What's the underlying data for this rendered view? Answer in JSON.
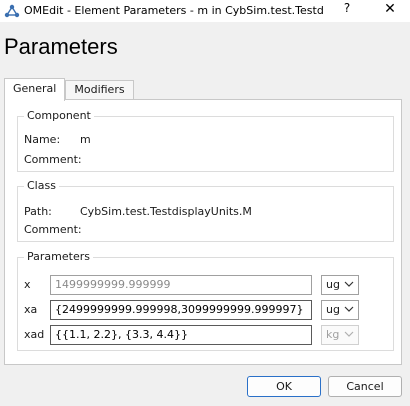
{
  "window": {
    "title": "OMEdit - Element Parameters - m in CybSim.test.Testdi...",
    "help_label": "?",
    "close_label": "✕"
  },
  "header": {
    "title": "Parameters"
  },
  "tabs": [
    {
      "label": "General",
      "active": true
    },
    {
      "label": "Modifiers",
      "active": false
    }
  ],
  "component": {
    "title": "Component",
    "name_label": "Name:",
    "name_value": "m",
    "comment_label": "Comment:",
    "comment_value": ""
  },
  "class_group": {
    "title": "Class",
    "path_label": "Path:",
    "path_value": "CybSim.test.TestdisplayUnits.M",
    "comment_label": "Comment:",
    "comment_value": ""
  },
  "parameters": {
    "title": "Parameters",
    "rows": [
      {
        "label": "x",
        "value": "1499999999.999999",
        "is_placeholder": true,
        "unit": "ug",
        "unit_enabled": true
      },
      {
        "label": "xa",
        "value": "{2499999999.999998,3099999999.999997}",
        "is_placeholder": false,
        "unit": "ug",
        "unit_enabled": true
      },
      {
        "label": "xad",
        "value": "{{1.1, 2.2}, {3.3, 4.4}}",
        "is_placeholder": false,
        "unit": "kg",
        "unit_enabled": false
      }
    ]
  },
  "buttons": {
    "ok_label": "OK",
    "cancel_label": "Cancel"
  },
  "colors": {
    "accent": "#2a70c8",
    "panel": "#ffffff",
    "background": "#f0f0f0"
  }
}
